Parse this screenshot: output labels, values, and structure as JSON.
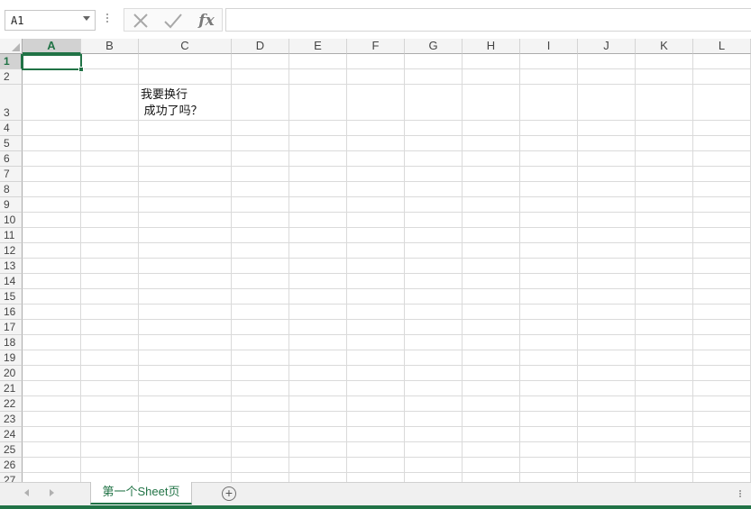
{
  "formula_bar": {
    "name_box_value": "A1",
    "formula_value": "",
    "insert_function_label": "fx"
  },
  "grid": {
    "columns": [
      "A",
      "B",
      "C",
      "D",
      "E",
      "F",
      "G",
      "H",
      "I",
      "J",
      "K",
      "L"
    ],
    "row_numbers": [
      "1",
      "2",
      "3",
      "4",
      "5",
      "6",
      "7",
      "8",
      "9",
      "10",
      "11",
      "12",
      "13",
      "14",
      "15",
      "16",
      "17",
      "18",
      "19",
      "20",
      "21",
      "22",
      "23",
      "24",
      "25",
      "26",
      "27"
    ],
    "active_cell": "A1",
    "cells": {
      "C3": "我要换行\n 成功了吗？"
    }
  },
  "sheet_tabs": {
    "tabs": [
      {
        "label": "第一个Sheet页",
        "active": true
      }
    ],
    "add_label": "+"
  },
  "colors": {
    "accent": "#217346",
    "grid_line": "#dadada",
    "header_bg": "#f4f4f4"
  }
}
